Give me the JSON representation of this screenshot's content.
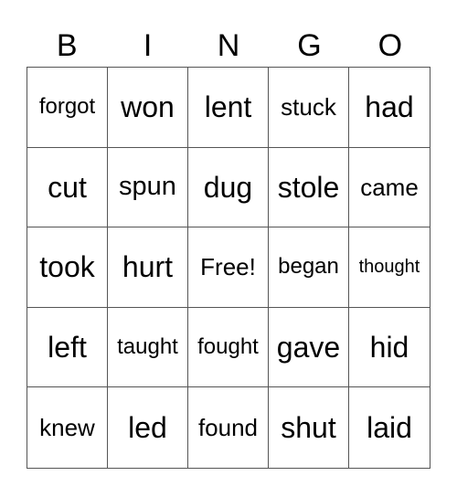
{
  "header": [
    "B",
    "I",
    "N",
    "G",
    "O"
  ],
  "cells": [
    {
      "text": "forgot",
      "size": "s4"
    },
    {
      "text": "won",
      "size": "s1"
    },
    {
      "text": "lent",
      "size": "s1"
    },
    {
      "text": "stuck",
      "size": "s3"
    },
    {
      "text": "had",
      "size": "s1"
    },
    {
      "text": "cut",
      "size": "s1"
    },
    {
      "text": "spun",
      "size": "s2"
    },
    {
      "text": "dug",
      "size": "s1"
    },
    {
      "text": "stole",
      "size": "s1"
    },
    {
      "text": "came",
      "size": "s3"
    },
    {
      "text": "took",
      "size": "s1"
    },
    {
      "text": "hurt",
      "size": "s1"
    },
    {
      "text": "Free!",
      "size": "s3"
    },
    {
      "text": "began",
      "size": "s4"
    },
    {
      "text": "thought",
      "size": "s5"
    },
    {
      "text": "left",
      "size": "s1"
    },
    {
      "text": "taught",
      "size": "s4"
    },
    {
      "text": "fought",
      "size": "s4"
    },
    {
      "text": "gave",
      "size": "s1"
    },
    {
      "text": "hid",
      "size": "s1"
    },
    {
      "text": "knew",
      "size": "s3"
    },
    {
      "text": "led",
      "size": "s1"
    },
    {
      "text": "found",
      "size": "s3"
    },
    {
      "text": "shut",
      "size": "s1"
    },
    {
      "text": "laid",
      "size": "s1"
    }
  ]
}
